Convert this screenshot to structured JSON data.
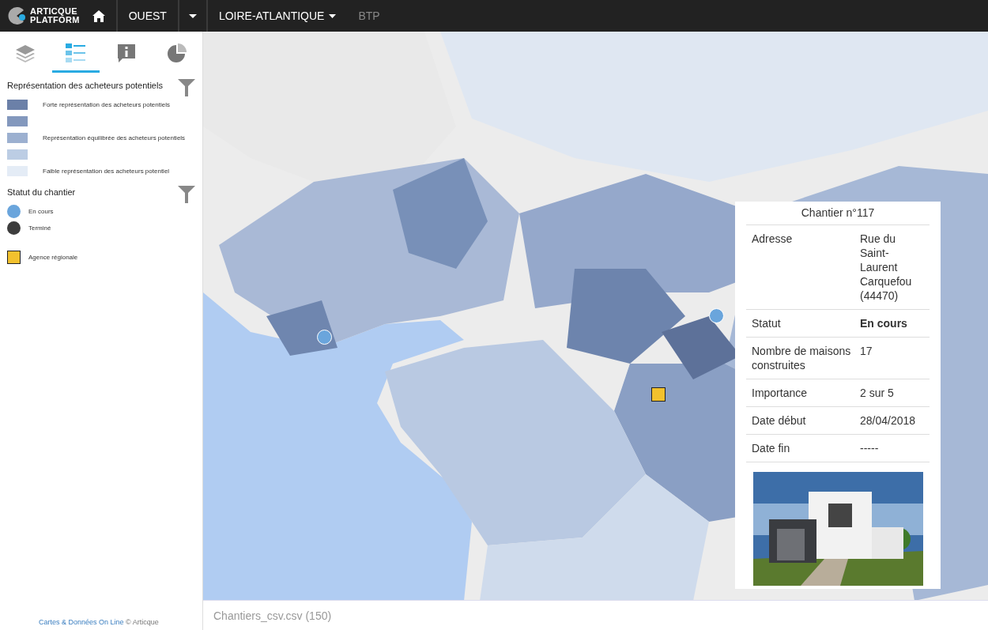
{
  "header": {
    "logo": [
      "ARTICQUE",
      "PLATFORM"
    ],
    "nav": [
      {
        "label": "OUEST",
        "muted": false,
        "dropdown": false
      },
      {
        "label": "LOIRE-ATLANTIQUE",
        "muted": false,
        "dropdown": true
      },
      {
        "label": "BTP",
        "muted": true,
        "dropdown": false
      }
    ]
  },
  "sidebar": {
    "tabs": [
      {
        "kind": "layers",
        "selected": false
      },
      {
        "kind": "legend",
        "selected": true
      },
      {
        "kind": "info",
        "selected": false
      },
      {
        "kind": "chart",
        "selected": false
      }
    ],
    "legend": [
      {
        "title": "Représentation des acheteurs potentiels",
        "items": [
          {
            "kind": "swatch",
            "color": "#6b80a8",
            "label": "Forte représentation des acheteurs potentiels"
          },
          {
            "kind": "swatch",
            "color": "#8398bd"
          },
          {
            "kind": "swatch",
            "color": "#9cb0d0",
            "label": "Représentation équilibrée des acheteurs potentiels"
          },
          {
            "kind": "swatch",
            "color": "#bccde4"
          },
          {
            "kind": "swatch",
            "color": "#e4ecf6",
            "label": "Faible représentation des acheteurs potentiel"
          }
        ]
      },
      {
        "title": "Statut du chantier",
        "items": [
          {
            "kind": "circle",
            "color": "#6aa5dc",
            "label": "En cours"
          },
          {
            "kind": "circle",
            "color": "#3d3d3d",
            "label": "Terminé"
          },
          {
            "kind": "square",
            "color": "#f2c12e",
            "label": "Agence régionale"
          }
        ]
      }
    ],
    "footer": {
      "link": "Cartes & Données On Line",
      "text": "© Articque"
    }
  },
  "map": {
    "markers": [
      {
        "kind": "circle",
        "color": "#6aa5dc"
      },
      {
        "kind": "circle",
        "color": "#6aa5dc"
      },
      {
        "kind": "square",
        "color": "#f2c12e"
      }
    ],
    "popup": {
      "title": "Chantier n°117",
      "rows": [
        {
          "label": "Adresse",
          "value": "Rue du Saint-Laurent Carquefou (44470)",
          "emphasis": false
        },
        {
          "label": "Statut",
          "value": "En cours",
          "emphasis": true
        },
        {
          "label": "Nombre de maisons construites",
          "value": "17",
          "emphasis": false
        },
        {
          "label": "Importance",
          "value": "2 sur 5",
          "emphasis": false
        },
        {
          "label": "Date début",
          "value": "28/04/2018",
          "emphasis": false
        },
        {
          "label": "Date fin",
          "value": "-----",
          "emphasis": false
        }
      ]
    }
  },
  "status_bar": {
    "file": "Chantiers_csv.csv (150)"
  }
}
